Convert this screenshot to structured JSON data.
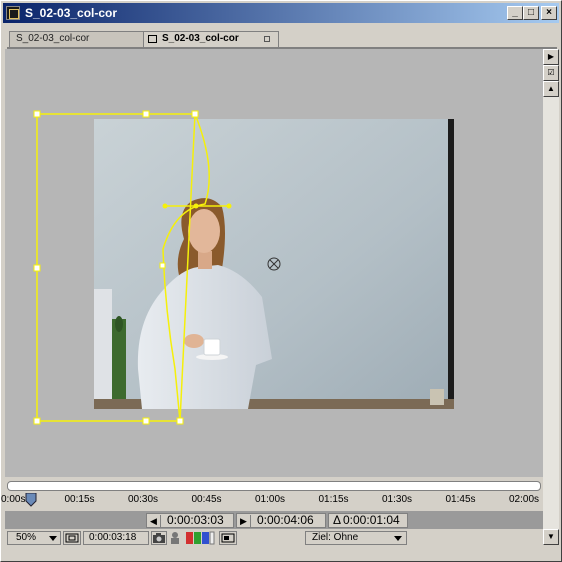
{
  "window": {
    "title": "S_02-03_col-cor"
  },
  "title_buttons": {
    "minimize": "_",
    "maximize": "□",
    "close": "×"
  },
  "tabs": [
    {
      "label": "S_02-03_col-cor",
      "active": false
    },
    {
      "label": "S_02-03_col-cor",
      "active": true
    }
  ],
  "timeline": {
    "ruler_labels": [
      "0:00s",
      "00:15s",
      "00:30s",
      "00:45s",
      "01:00s",
      "01:15s",
      "01:30s",
      "01:45s",
      "02:00s"
    ],
    "playhead_fraction": 0.03
  },
  "time_controls": {
    "set_in_time": "0:00:03:03",
    "set_out_time": "0:00:04:06",
    "duration_symbol": "Δ",
    "duration": "0:00:01:04"
  },
  "status": {
    "zoom": "50%",
    "current_time": "0:00:03:18",
    "target_label": "Ziel: Ohne"
  },
  "colors": {
    "mask_path": "#f5f00a",
    "canvas_bg": "#b6b6b6",
    "titlebar_start": "#0a246a",
    "titlebar_end": "#a6caf0"
  },
  "icons": {
    "app": "composition-icon",
    "anchor": "anchor-point-icon",
    "snapshot": "camera-icon",
    "channels": "rgb-channels-icon",
    "region": "region-of-interest-icon",
    "safe_zones": "title-action-safe-icon"
  }
}
